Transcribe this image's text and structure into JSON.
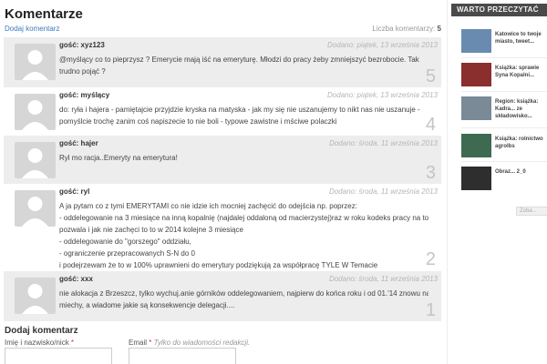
{
  "section": {
    "title": "Komentarze",
    "add_link": "Dodaj komentarz",
    "count_label": "Liczba komentarzy:",
    "count_value": "5"
  },
  "comments": [
    {
      "author": "gość: xyz123",
      "date": "Dodano: piątek, 13 września 2013",
      "lines": [
        "@myślący co to pieprzysz ? Emerycie mają iść na emeryturę. Młodzi do pracy żeby zmniejszyć bezrobocie. Tak",
        "trudno pojąć ?"
      ],
      "number": "5"
    },
    {
      "author": "gość: myślący",
      "date": "Dodano: piątek, 13 września 2013",
      "lines": [
        "do: ryła i hajera - pamiętajcie przyjdzie kryska na matyska - jak my się nie uszanujemy to nikt nas nie uszanuje -",
        "pomyślcie trochę zanim coś napiszecie to nie boli - typowe zawistne i mściwe polaczki"
      ],
      "number": "4"
    },
    {
      "author": "gość: hajer",
      "date": "Dodano: środa, 11 września 2013",
      "lines": [
        "Ryl mo racja..Emeryty na emerytura!"
      ],
      "number": "3"
    },
    {
      "author": "gość: ryl",
      "date": "Dodano: środa, 11 września 2013",
      "lines": [
        "A ja pytam co z tymi EMERYTAMI co nie idzie ich mocniej zachęcić do odejścia np. poprzez:",
        "- oddelegowanie na 3 miesiące na inną kopalnię (najdalej oddaloną od macierzystej)raz w roku kodeks pracy na to",
        "pozwala i jak nie zachęci to to w 2014 kolejne 3 miesiące",
        "- oddelegowanie do \"gorszego\" oddziału,",
        "- ograniczenie przepracowanych S-N do 0",
        "i podejrzewam że to w 100% uprawnieni do emerytury podziękują za współpracę TYLE W Temacie"
      ],
      "number": "2"
    },
    {
      "author": "gość: xxx",
      "date": "Dodano: środa, 11 września 2013",
      "lines": [
        "nie alokacja z Brzeszcz, tylko wychuj.anie górników oddelegowaniem, najpierw do końca roku i od 01.'14 znowu na 3",
        "miechy, a wiadome jakie są konsekwencje delegacji...."
      ],
      "number": "1"
    }
  ],
  "form": {
    "title": "Dodaj komentarz",
    "name_label": "Imię i nazwisko/nick",
    "required_mark": "*",
    "email_label": "Email",
    "email_hint": "Tylko do wiadomości redakcji."
  },
  "sidebar": {
    "header": "WARTO PRZECZYTAĆ",
    "items": [
      {
        "text": "Katowice to twoje miasto, tweet...",
        "color": "#6a8bb0"
      },
      {
        "text": "Książka: sprawie Syna Kopalni...",
        "color": "#8b2e2e"
      },
      {
        "text": "Region: książka: Kadra... ze składowisko...",
        "color": "#7a8a96"
      },
      {
        "text": "Książka: rolnictwo agrolbs",
        "color": "#3f6a52"
      },
      {
        "text": "Obraz... 2_0",
        "color": "#2e2e2e"
      }
    ],
    "more_label": "Zoba..."
  }
}
